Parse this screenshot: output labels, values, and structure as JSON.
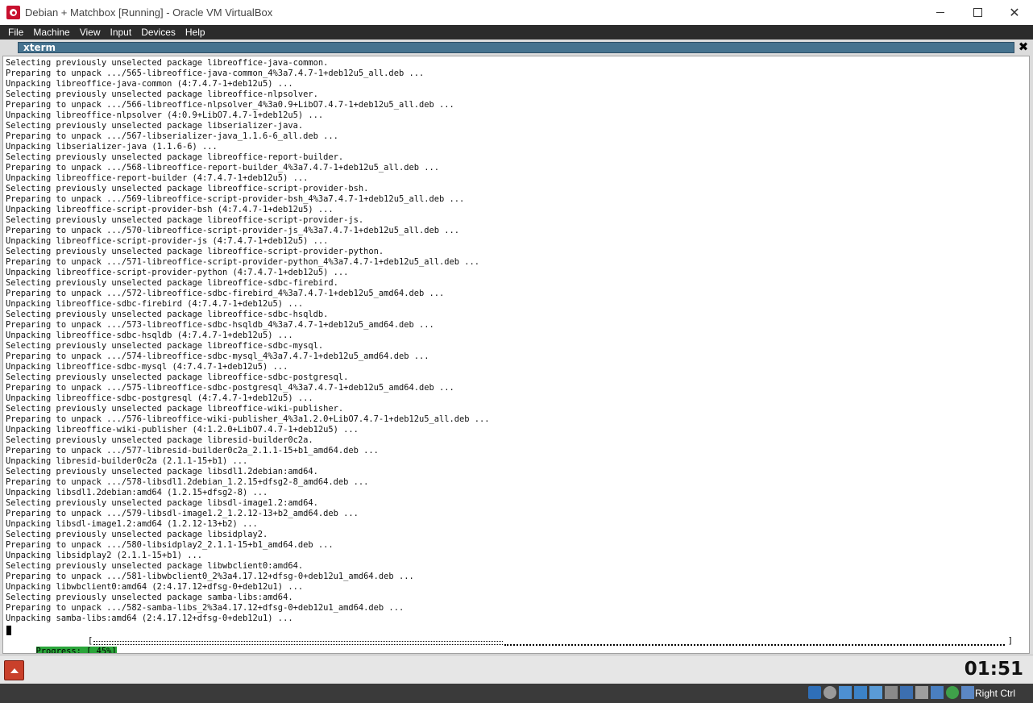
{
  "window": {
    "title": "Debian + Matchbox [Running] - Oracle VM VirtualBox"
  },
  "menu": [
    "File",
    "Machine",
    "View",
    "Input",
    "Devices",
    "Help"
  ],
  "xterm": {
    "title": "xterm",
    "lines": [
      "Selecting previously unselected package libreoffice-java-common.",
      "Preparing to unpack .../565-libreoffice-java-common_4%3a7.4.7-1+deb12u5_all.deb ...",
      "Unpacking libreoffice-java-common (4:7.4.7-1+deb12u5) ...",
      "Selecting previously unselected package libreoffice-nlpsolver.",
      "Preparing to unpack .../566-libreoffice-nlpsolver_4%3a0.9+LibO7.4.7-1+deb12u5_all.deb ...",
      "Unpacking libreoffice-nlpsolver (4:0.9+LibO7.4.7-1+deb12u5) ...",
      "Selecting previously unselected package libserializer-java.",
      "Preparing to unpack .../567-libserializer-java_1.1.6-6_all.deb ...",
      "Unpacking libserializer-java (1.1.6-6) ...",
      "Selecting previously unselected package libreoffice-report-builder.",
      "Preparing to unpack .../568-libreoffice-report-builder_4%3a7.4.7-1+deb12u5_all.deb ...",
      "Unpacking libreoffice-report-builder (4:7.4.7-1+deb12u5) ...",
      "Selecting previously unselected package libreoffice-script-provider-bsh.",
      "Preparing to unpack .../569-libreoffice-script-provider-bsh_4%3a7.4.7-1+deb12u5_all.deb ...",
      "Unpacking libreoffice-script-provider-bsh (4:7.4.7-1+deb12u5) ...",
      "Selecting previously unselected package libreoffice-script-provider-js.",
      "Preparing to unpack .../570-libreoffice-script-provider-js_4%3a7.4.7-1+deb12u5_all.deb ...",
      "Unpacking libreoffice-script-provider-js (4:7.4.7-1+deb12u5) ...",
      "Selecting previously unselected package libreoffice-script-provider-python.",
      "Preparing to unpack .../571-libreoffice-script-provider-python_4%3a7.4.7-1+deb12u5_all.deb ...",
      "Unpacking libreoffice-script-provider-python (4:7.4.7-1+deb12u5) ...",
      "Selecting previously unselected package libreoffice-sdbc-firebird.",
      "Preparing to unpack .../572-libreoffice-sdbc-firebird_4%3a7.4.7-1+deb12u5_amd64.deb ...",
      "Unpacking libreoffice-sdbc-firebird (4:7.4.7-1+deb12u5) ...",
      "Selecting previously unselected package libreoffice-sdbc-hsqldb.",
      "Preparing to unpack .../573-libreoffice-sdbc-hsqldb_4%3a7.4.7-1+deb12u5_amd64.deb ...",
      "Unpacking libreoffice-sdbc-hsqldb (4:7.4.7-1+deb12u5) ...",
      "Selecting previously unselected package libreoffice-sdbc-mysql.",
      "Preparing to unpack .../574-libreoffice-sdbc-mysql_4%3a7.4.7-1+deb12u5_amd64.deb ...",
      "Unpacking libreoffice-sdbc-mysql (4:7.4.7-1+deb12u5) ...",
      "Selecting previously unselected package libreoffice-sdbc-postgresql.",
      "Preparing to unpack .../575-libreoffice-sdbc-postgresql_4%3a7.4.7-1+deb12u5_amd64.deb ...",
      "Unpacking libreoffice-sdbc-postgresql (4:7.4.7-1+deb12u5) ...",
      "Selecting previously unselected package libreoffice-wiki-publisher.",
      "Preparing to unpack .../576-libreoffice-wiki-publisher_4%3a1.2.0+LibO7.4.7-1+deb12u5_all.deb ...",
      "Unpacking libreoffice-wiki-publisher (4:1.2.0+LibO7.4.7-1+deb12u5) ...",
      "Selecting previously unselected package libresid-builder0c2a.",
      "Preparing to unpack .../577-libresid-builder0c2a_2.1.1-15+b1_amd64.deb ...",
      "Unpacking libresid-builder0c2a (2.1.1-15+b1) ...",
      "Selecting previously unselected package libsdl1.2debian:amd64.",
      "Preparing to unpack .../578-libsdl1.2debian_1.2.15+dfsg2-8_amd64.deb ...",
      "Unpacking libsdl1.2debian:amd64 (1.2.15+dfsg2-8) ...",
      "Selecting previously unselected package libsdl-image1.2:amd64.",
      "Preparing to unpack .../579-libsdl-image1.2_1.2.12-13+b2_amd64.deb ...",
      "Unpacking libsdl-image1.2:amd64 (1.2.12-13+b2) ...",
      "Selecting previously unselected package libsidplay2.",
      "Preparing to unpack .../580-libsidplay2_2.1.1-15+b1_amd64.deb ...",
      "Unpacking libsidplay2 (2.1.1-15+b1) ...",
      "Selecting previously unselected package libwbclient0:amd64.",
      "Preparing to unpack .../581-libwbclient0_2%3a4.17.12+dfsg-0+deb12u1_amd64.deb ...",
      "Unpacking libwbclient0:amd64 (2:4.17.12+dfsg-0+deb12u1) ...",
      "Selecting previously unselected package samba-libs:amd64.",
      "Preparing to unpack .../582-samba-libs_2%3a4.17.12+dfsg-0+deb12u1_amd64.deb ...",
      "Unpacking samba-libs:amd64 (2:4.17.12+dfsg-0+deb12u1) ..."
    ],
    "progress": {
      "label": "Progress: [ 45%]",
      "fraction": 0.45,
      "open_bracket": "[",
      "close_bracket": "]"
    }
  },
  "panel": {
    "clock": "01:51"
  },
  "statusbar": {
    "icons": [
      "hard-disk-icon",
      "optical-disk-icon",
      "audio-icon",
      "network-icon",
      "usb-icon",
      "shared-folder-icon",
      "display-icon",
      "recording-icon",
      "virtualization-icon",
      "mouse-integration-icon",
      "keyboard-icon"
    ],
    "host_key": "Right Ctrl",
    "colors": {
      "accent": "#2aa53a",
      "xterm_title": "#46738f"
    }
  }
}
